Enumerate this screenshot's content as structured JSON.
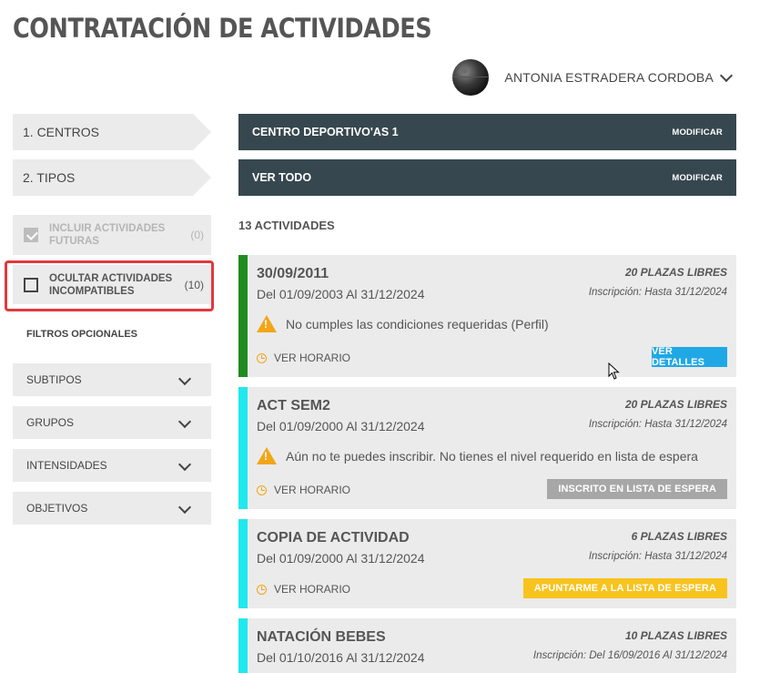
{
  "page": {
    "title": "CONTRATACIÓN DE ACTIVIDADES"
  },
  "user": {
    "name": "ANTONIA ESTRADERA CORDOBA",
    "avatar_icon": "avatar-image",
    "menu_icon": "chevron-down-icon"
  },
  "steps": [
    {
      "label": "1. CENTROS"
    },
    {
      "label": "2. TIPOS"
    }
  ],
  "filters": [
    {
      "label_line1": "INCLUIR ACTIVIDADES",
      "label_line2": "FUTURAS",
      "count": "(0)",
      "checked": true,
      "disabled": true
    },
    {
      "label_line1": "OCULTAR ACTIVIDADES",
      "label_line2": "INCOMPATIBLES",
      "count": "(10)",
      "checked": false,
      "disabled": false
    }
  ],
  "optional_filters": {
    "label": "FILTROS OPCIONALES",
    "items": [
      {
        "label": "SUBTIPOS"
      },
      {
        "label": "GRUPOS"
      },
      {
        "label": "INTENSIDADES"
      },
      {
        "label": "OBJETIVOS"
      }
    ]
  },
  "selection_bars": [
    {
      "title": "CENTRO DEPORTIVO'AS 1",
      "action": "MODIFICAR"
    },
    {
      "title": "VER TODO",
      "action": "MODIFICAR"
    }
  ],
  "activities_count": "13 ACTIVIDADES",
  "activities": [
    {
      "name": "30/09/2011",
      "dates": "Del 01/09/2003 Al 31/12/2024",
      "plazas": "20 PLAZAS LIBRES",
      "inscripcion": "Inscripción: Hasta 31/12/2024",
      "warning": "No cumples las condiciones requeridas (Perfil)",
      "horario": "VER HORARIO",
      "button": "VER DETALLES",
      "accent": "#1f8a1f",
      "button_color": "#20a8e6"
    },
    {
      "name": "ACT SEM2",
      "dates": "Del 01/09/2000 Al 31/12/2024",
      "plazas": "20 PLAZAS LIBRES",
      "inscripcion": "Inscripción: Hasta 31/12/2024",
      "warning": "Aún no te puedes inscribir. No tienes el nivel requerido en lista de espera",
      "horario": "VER HORARIO",
      "button": "INSCRITO EN LISTA DE ESPERA",
      "accent": "#1fe8ee",
      "button_color": "#a7a7a7"
    },
    {
      "name": "COPIA DE ACTIVIDAD",
      "dates": "Del 01/09/2000 Al 31/12/2024",
      "plazas": "6 PLAZAS LIBRES",
      "inscripcion": "Inscripción: Hasta 31/12/2024",
      "horario": "VER HORARIO",
      "button": "APUNTARME A LA LISTA DE ESPERA",
      "accent": "#1fe8ee",
      "button_color": "#f9c31e"
    },
    {
      "name": "NATACIÓN BEBES",
      "dates": "Del 01/10/2016 Al 31/12/2024",
      "plazas": "10 PLAZAS LIBRES",
      "inscripcion": "Inscripción: Del 16/09/2016 Al 31/12/2024",
      "accent": "#1fe8ee"
    }
  ]
}
